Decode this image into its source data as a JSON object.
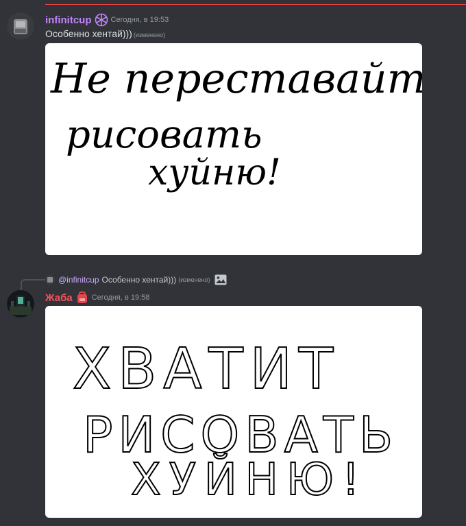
{
  "messages": [
    {
      "username": "infinitcup",
      "username_color": "#c084fc",
      "badge_icon": "snowflake-badge-icon",
      "timestamp": "Сегодня, в 19:53",
      "text": "Особенно хентай)))",
      "edited": "(изменено)",
      "image_text_lines": [
        "Не переставайте",
        "рисовать",
        "хуйню!"
      ]
    },
    {
      "reply": {
        "mention": "@infinitcup",
        "text": "Особенно хентай)))",
        "edited": "(изменено)",
        "attachment_icon": "image-icon"
      },
      "username": "Жаба",
      "username_color": "#f2545b",
      "badge_icon": "backpack-badge-icon",
      "timestamp": "Сегодня, в 19:58",
      "image_text_lines": [
        "ХВАТИТ",
        "РИСОВАТЬ",
        "ХУЙНЮ!"
      ]
    }
  ],
  "colors": {
    "background": "#313338",
    "new_divider": "#f23f43",
    "mention": "#c9a8ff"
  }
}
